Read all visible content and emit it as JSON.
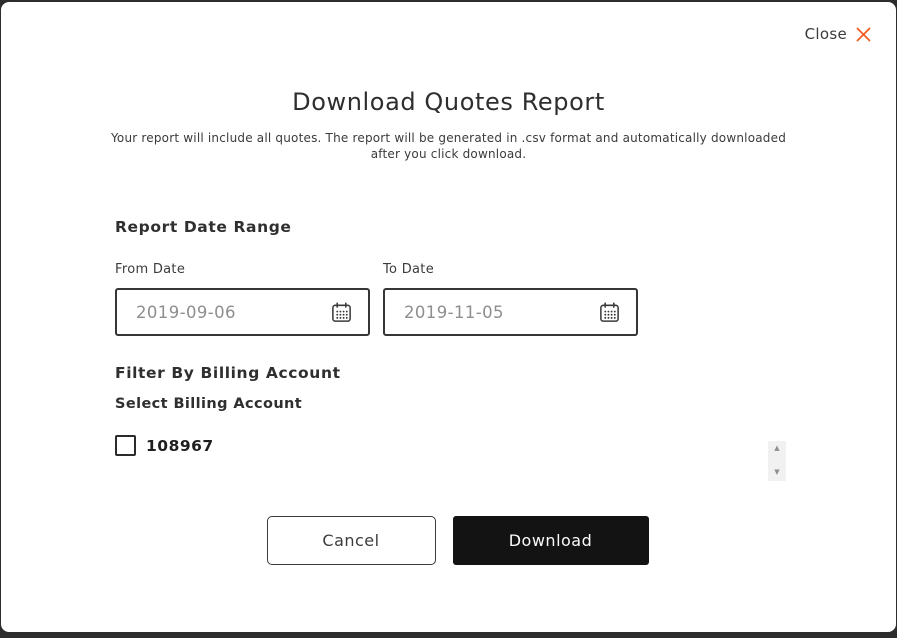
{
  "colors": {
    "accent_orange": "#f25b22",
    "text_dark": "#333333",
    "text_muted": "#8e8e8e",
    "button_dark_bg": "#131313",
    "backdrop": "#2d2d2d",
    "scrollbar_track": "#f1f1f1",
    "scrollbar_arrow": "#8f8f8f"
  },
  "modal": {
    "close_button": {
      "label": "Close",
      "icon": "close-x-icon"
    },
    "title": "Download Quotes Report",
    "description": "Your report will include all quotes. The report will be generated in .csv format and automatically downloaded after you click download.",
    "date_range": {
      "heading": "Report Date Range",
      "from_date": {
        "label": "From Date",
        "value": "2019-09-06",
        "icon": "calendar-icon"
      },
      "to_date": {
        "label": "To Date",
        "value": "2019-11-05",
        "icon": "calendar-icon"
      }
    },
    "billing_filter": {
      "heading": "Filter By Billing Account",
      "subheading": "Select Billing Account",
      "accounts": [
        {
          "id": "108967",
          "checked": false
        }
      ]
    },
    "scrollbar": {
      "up_icon": "▲",
      "down_icon": "▼"
    },
    "actions": {
      "cancel_label": "Cancel",
      "download_label": "Download"
    }
  }
}
